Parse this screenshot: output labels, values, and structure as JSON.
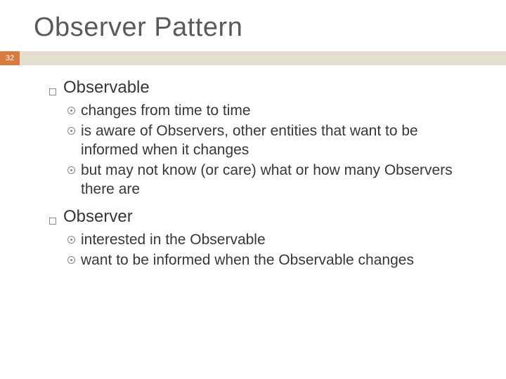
{
  "title": "Observer Pattern",
  "page_number": "32",
  "sections": [
    {
      "heading": "Observable",
      "items": [
        "changes from time to time",
        "is aware of Observers, other entities that want to be informed when it changes",
        "but may not know (or care) what or how many Observers there are"
      ]
    },
    {
      "heading": "Observer",
      "items": [
        "interested in the Observable",
        "want to be informed when the Observable changes"
      ]
    }
  ]
}
